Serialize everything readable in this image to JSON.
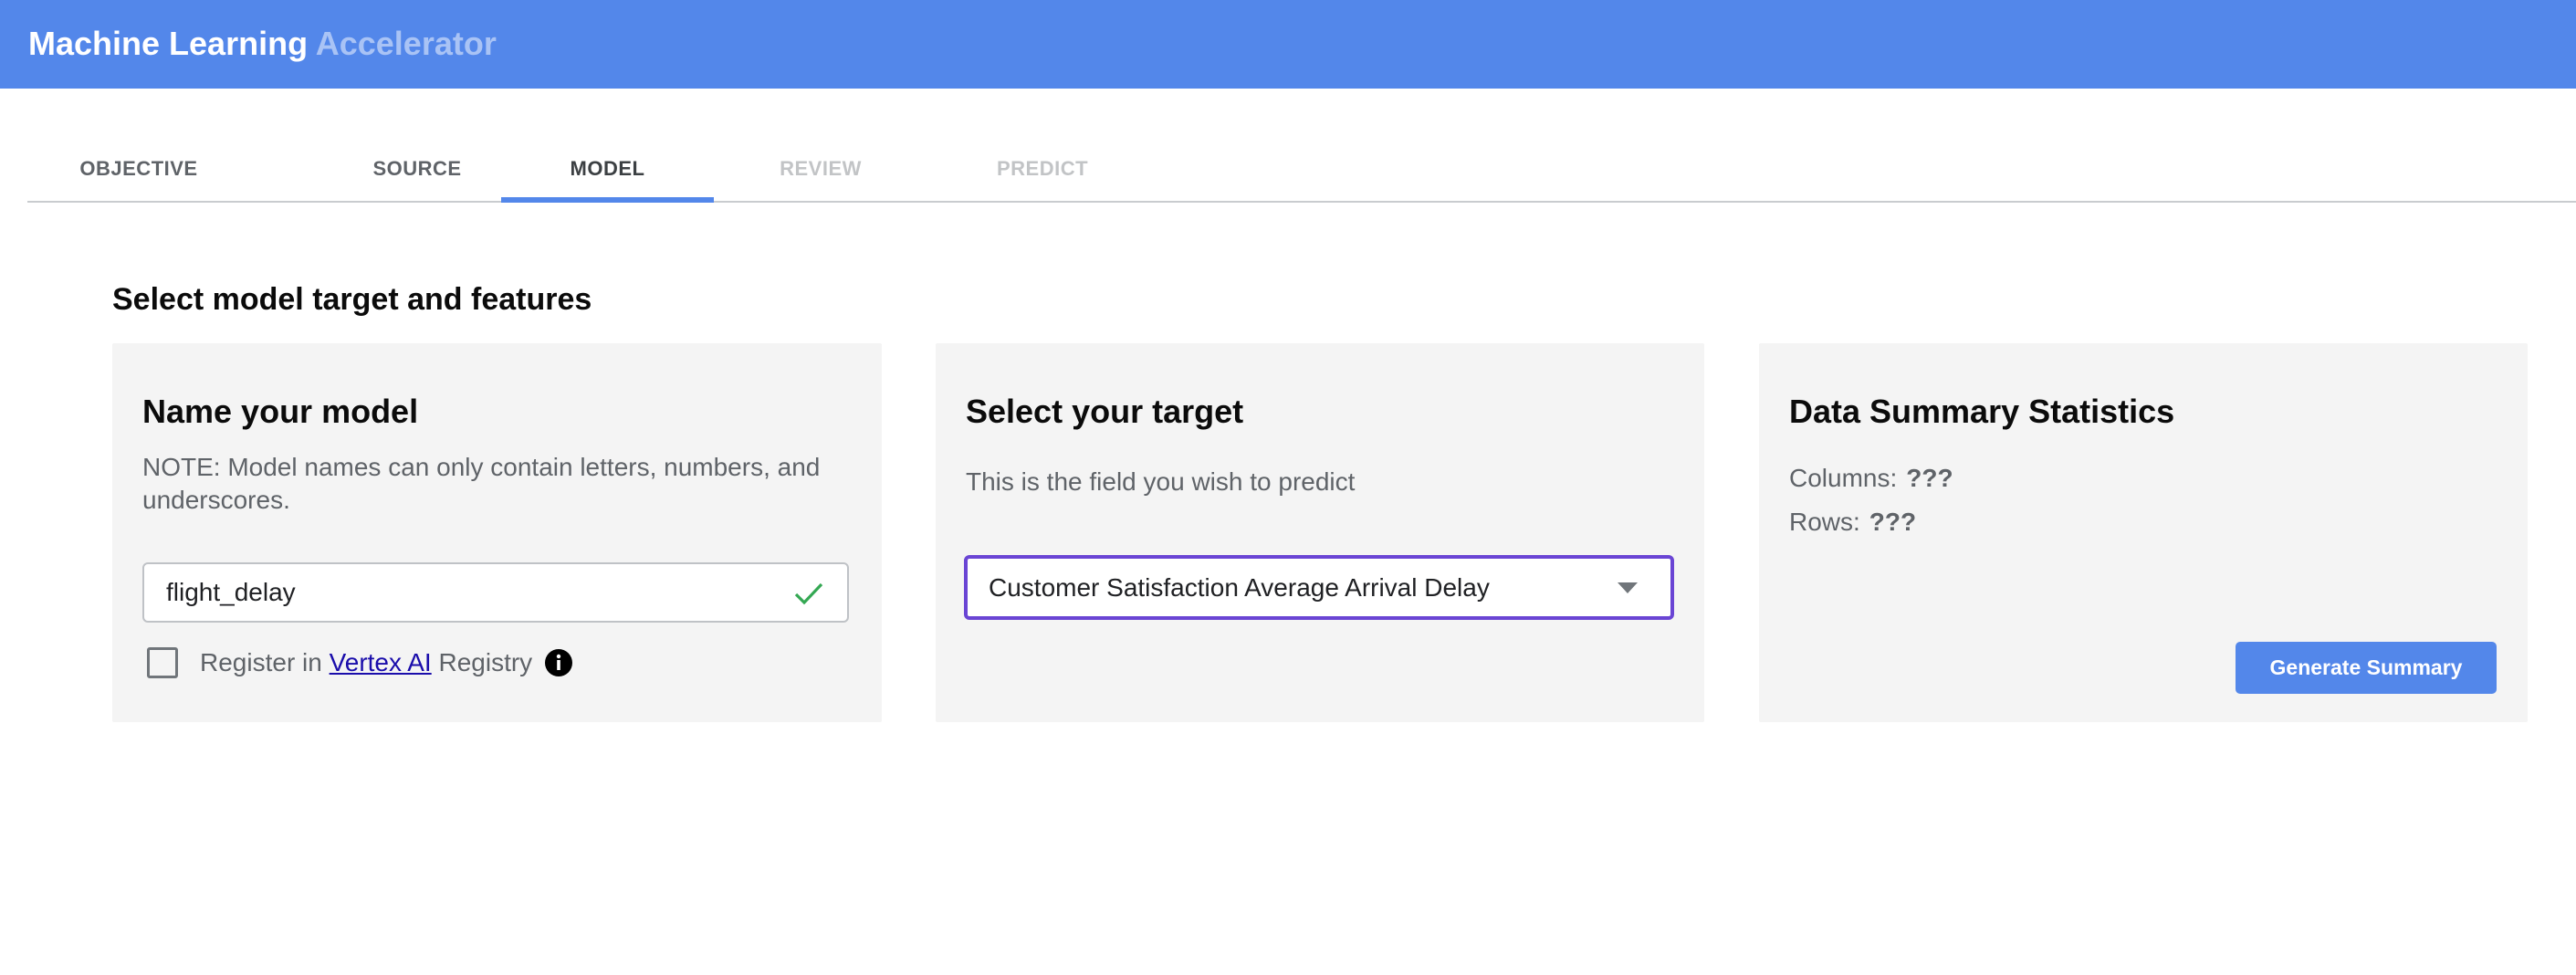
{
  "app": {
    "title_primary": "Machine Learning",
    "title_secondary": "Accelerator"
  },
  "tabs": [
    {
      "label": "OBJECTIVE",
      "state": "enabled"
    },
    {
      "label": "SOURCE",
      "state": "enabled"
    },
    {
      "label": "MODEL",
      "state": "active"
    },
    {
      "label": "REVIEW",
      "state": "disabled"
    },
    {
      "label": "PREDICT",
      "state": "disabled"
    }
  ],
  "page": {
    "title": "Select model target and features"
  },
  "model_card": {
    "title": "Name your model",
    "note": "NOTE: Model names can only contain letters, numbers, and underscores.",
    "model_name_value": "flight_delay",
    "valid_icon": "check-icon",
    "register_checked": false,
    "register_prefix": "Register in ",
    "register_link": "Vertex AI",
    "register_suffix": " Registry",
    "info_icon": "info-icon"
  },
  "target_card": {
    "title": "Select your target",
    "description": "This is the field you wish to predict",
    "selected_target": "Customer Satisfaction Average Arrival Delay",
    "dropdown_icon": "dropdown-arrow-icon"
  },
  "summary_card": {
    "title": "Data Summary Statistics",
    "columns_label": "Columns:",
    "columns_value": "???",
    "rows_label": "Rows:",
    "rows_value": "???",
    "button_label": "Generate Summary"
  },
  "colors": {
    "header": "#5387ea",
    "accent": "#5387ea",
    "focus": "#6a45d4",
    "valid": "#34a853",
    "card_bg": "#f4f4f4"
  }
}
